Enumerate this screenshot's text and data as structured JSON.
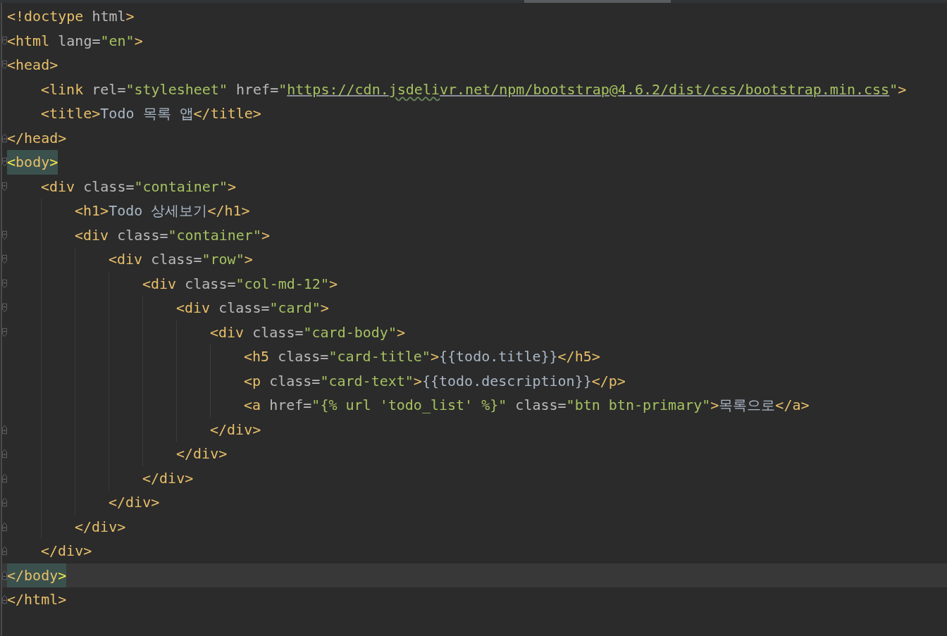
{
  "editor": {
    "lines": [
      {
        "fold_start": false,
        "fold_end": false,
        "current": false,
        "matched": false,
        "tokens": [
          {
            "kind": "tag",
            "text": "<!doctype"
          },
          {
            "kind": "attr",
            "text": " html"
          },
          {
            "kind": "tag",
            "text": ">"
          }
        ]
      },
      {
        "fold_start": true,
        "fold_end": false,
        "current": false,
        "matched": false,
        "tokens": [
          {
            "kind": "tag",
            "text": "<html"
          },
          {
            "kind": "attr",
            "text": " lang="
          },
          {
            "kind": "string",
            "text": "\"en\""
          },
          {
            "kind": "tag",
            "text": ">"
          }
        ]
      },
      {
        "fold_start": true,
        "fold_end": false,
        "current": false,
        "matched": false,
        "tokens": [
          {
            "kind": "tag",
            "text": "<head>"
          }
        ]
      },
      {
        "fold_start": false,
        "fold_end": false,
        "current": false,
        "matched": false,
        "tokens": [
          {
            "kind": "tag",
            "text": "    <link"
          },
          {
            "kind": "attr",
            "text": " rel="
          },
          {
            "kind": "string",
            "text": "\"stylesheet\""
          },
          {
            "kind": "attr",
            "text": " href="
          },
          {
            "kind": "string",
            "text": "\""
          },
          {
            "kind": "url",
            "text": "https://cdn."
          },
          {
            "kind": "typo",
            "text": "jsdeli"
          },
          {
            "kind": "url",
            "text": "vr.net/npm/bootstrap@4.6.2/dist/css/bootstrap.min.css"
          },
          {
            "kind": "string",
            "text": "\""
          },
          {
            "kind": "tag",
            "text": ">"
          }
        ]
      },
      {
        "fold_start": false,
        "fold_end": false,
        "current": false,
        "matched": false,
        "tokens": [
          {
            "kind": "tag",
            "text": "    <title>"
          },
          {
            "kind": "text",
            "text": "Todo 목록 앱"
          },
          {
            "kind": "tag",
            "text": "</title>"
          }
        ]
      },
      {
        "fold_start": false,
        "fold_end": true,
        "current": false,
        "matched": false,
        "tokens": [
          {
            "kind": "tag",
            "text": "</head>"
          }
        ]
      },
      {
        "fold_start": true,
        "fold_end": false,
        "current": false,
        "matched": true,
        "tokens": [
          {
            "kind": "match",
            "text": "<"
          },
          {
            "kind": "tag",
            "text": "body"
          },
          {
            "kind": "match",
            "text": ">"
          }
        ]
      },
      {
        "fold_start": true,
        "fold_end": false,
        "current": false,
        "matched": false,
        "tokens": [
          {
            "kind": "tag",
            "text": "    <div"
          },
          {
            "kind": "attr",
            "text": " class="
          },
          {
            "kind": "string",
            "text": "\"container\""
          },
          {
            "kind": "tag",
            "text": ">"
          }
        ]
      },
      {
        "fold_start": false,
        "fold_end": false,
        "current": false,
        "matched": false,
        "tokens": [
          {
            "kind": "tag",
            "text": "        <h1>"
          },
          {
            "kind": "text",
            "text": "Todo 상세보기"
          },
          {
            "kind": "tag",
            "text": "</h1>"
          }
        ]
      },
      {
        "fold_start": true,
        "fold_end": false,
        "current": false,
        "matched": false,
        "tokens": [
          {
            "kind": "tag",
            "text": "        <div"
          },
          {
            "kind": "attr",
            "text": " class="
          },
          {
            "kind": "string",
            "text": "\"container\""
          },
          {
            "kind": "tag",
            "text": ">"
          }
        ]
      },
      {
        "fold_start": true,
        "fold_end": false,
        "current": false,
        "matched": false,
        "tokens": [
          {
            "kind": "tag",
            "text": "            <div"
          },
          {
            "kind": "attr",
            "text": " class="
          },
          {
            "kind": "string",
            "text": "\"row\""
          },
          {
            "kind": "tag",
            "text": ">"
          }
        ]
      },
      {
        "fold_start": true,
        "fold_end": false,
        "current": false,
        "matched": false,
        "tokens": [
          {
            "kind": "tag",
            "text": "                <div"
          },
          {
            "kind": "attr",
            "text": " class="
          },
          {
            "kind": "string",
            "text": "\"col-md-12\""
          },
          {
            "kind": "tag",
            "text": ">"
          }
        ]
      },
      {
        "fold_start": true,
        "fold_end": false,
        "current": false,
        "matched": false,
        "tokens": [
          {
            "kind": "tag",
            "text": "                    <div"
          },
          {
            "kind": "attr",
            "text": " class="
          },
          {
            "kind": "string",
            "text": "\"card\""
          },
          {
            "kind": "tag",
            "text": ">"
          }
        ]
      },
      {
        "fold_start": true,
        "fold_end": false,
        "current": false,
        "matched": false,
        "tokens": [
          {
            "kind": "tag",
            "text": "                        <div"
          },
          {
            "kind": "attr",
            "text": " class="
          },
          {
            "kind": "string",
            "text": "\"card-body\""
          },
          {
            "kind": "tag",
            "text": ">"
          }
        ]
      },
      {
        "fold_start": false,
        "fold_end": false,
        "current": false,
        "matched": false,
        "tokens": [
          {
            "kind": "tag",
            "text": "                            <h5"
          },
          {
            "kind": "attr",
            "text": " class="
          },
          {
            "kind": "string",
            "text": "\"card-title\""
          },
          {
            "kind": "tag",
            "text": ">"
          },
          {
            "kind": "text",
            "text": "{{todo.title}}"
          },
          {
            "kind": "tag",
            "text": "</h5>"
          }
        ]
      },
      {
        "fold_start": false,
        "fold_end": false,
        "current": false,
        "matched": false,
        "tokens": [
          {
            "kind": "tag",
            "text": "                            <p"
          },
          {
            "kind": "attr",
            "text": " class="
          },
          {
            "kind": "string",
            "text": "\"card-text\""
          },
          {
            "kind": "tag",
            "text": ">"
          },
          {
            "kind": "text",
            "text": "{{todo.description}}"
          },
          {
            "kind": "tag",
            "text": "</p>"
          }
        ]
      },
      {
        "fold_start": false,
        "fold_end": false,
        "current": false,
        "matched": false,
        "tokens": [
          {
            "kind": "tag",
            "text": "                            <a"
          },
          {
            "kind": "attr",
            "text": " href="
          },
          {
            "kind": "string",
            "text": "\"{% url 'todo_list' %}\""
          },
          {
            "kind": "attr",
            "text": " class="
          },
          {
            "kind": "string",
            "text": "\"btn btn-primary\""
          },
          {
            "kind": "tag",
            "text": ">"
          },
          {
            "kind": "text",
            "text": "목록으로"
          },
          {
            "kind": "tag",
            "text": "</a>"
          }
        ]
      },
      {
        "fold_start": false,
        "fold_end": true,
        "current": false,
        "matched": false,
        "tokens": [
          {
            "kind": "tag",
            "text": "                        </div>"
          }
        ]
      },
      {
        "fold_start": false,
        "fold_end": true,
        "current": false,
        "matched": false,
        "tokens": [
          {
            "kind": "tag",
            "text": "                    </div>"
          }
        ]
      },
      {
        "fold_start": false,
        "fold_end": true,
        "current": false,
        "matched": false,
        "tokens": [
          {
            "kind": "tag",
            "text": "                </div>"
          }
        ]
      },
      {
        "fold_start": false,
        "fold_end": true,
        "current": false,
        "matched": false,
        "tokens": [
          {
            "kind": "tag",
            "text": "            </div>"
          }
        ]
      },
      {
        "fold_start": false,
        "fold_end": true,
        "current": false,
        "matched": false,
        "tokens": [
          {
            "kind": "tag",
            "text": "        </div>"
          }
        ]
      },
      {
        "fold_start": false,
        "fold_end": true,
        "current": false,
        "matched": false,
        "tokens": [
          {
            "kind": "tag",
            "text": "    </div>"
          }
        ]
      },
      {
        "fold_start": false,
        "fold_end": true,
        "current": true,
        "matched": true,
        "tokens": [
          {
            "kind": "tag",
            "text": "</body"
          },
          {
            "kind": "match",
            "text": ">"
          }
        ]
      },
      {
        "fold_start": false,
        "fold_end": true,
        "current": false,
        "matched": false,
        "tokens": [
          {
            "kind": "tag",
            "text": "</html>"
          }
        ]
      }
    ]
  }
}
